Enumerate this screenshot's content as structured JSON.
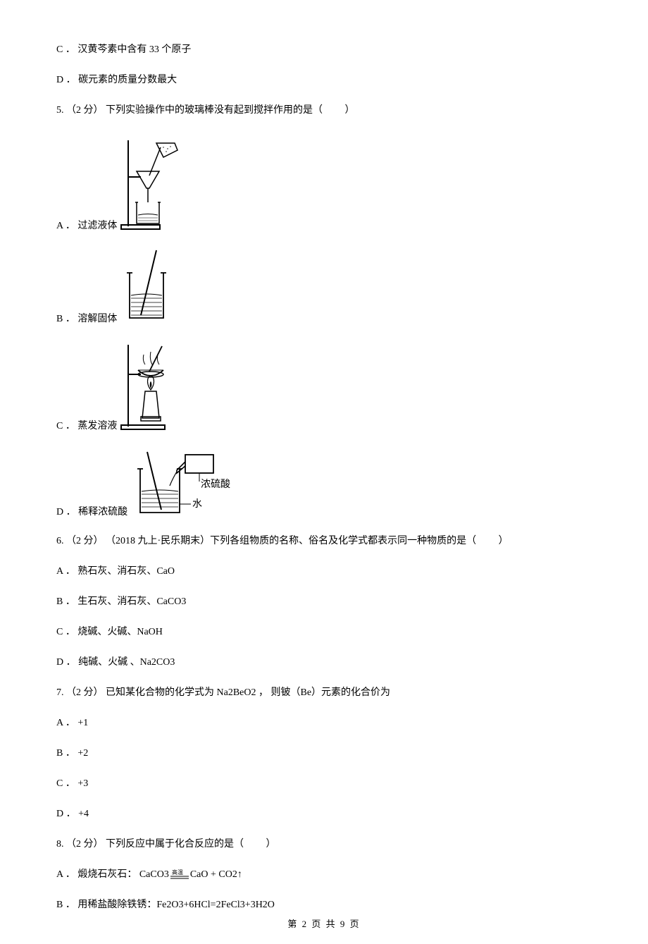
{
  "q4": {
    "optC": "C ． 汉黄芩素中含有 33 个原子",
    "optD": "D ． 碳元素的质量分数最大"
  },
  "q5": {
    "stem": "5.  （2 分）  下列实验操作中的玻璃棒没有起到搅拌作用的是（　 　）",
    "optA": "A ． 过滤液体",
    "optB": "B ． 溶解固体",
    "optC": "C ． 蒸发溶液",
    "optD": "D ． 稀释浓硫酸",
    "labelAcid": "浓硫酸",
    "labelWater": "水"
  },
  "q6": {
    "stem": "6.  （2 分） （2018 九上·民乐期末）下列各组物质的名称、俗名及化学式都表示同一种物质的是（　 　）",
    "optA": "A ． 熟石灰、消石灰、CaO",
    "optB": "B ． 生石灰、消石灰、CaCO3",
    "optC": "C ． 烧碱、火碱、NaOH",
    "optD": "D ． 纯碱、火碱 、Na2CO3"
  },
  "q7": {
    "stem": "7.  （2 分）  已知某化合物的化学式为 Na2BeO2 ，  则铍（Be）元素的化合价为",
    "optA": "A ． +1",
    "optB": "B ． +2",
    "optC": "C ． +3",
    "optD": "D ． +4"
  },
  "q8": {
    "stem": "8.  （2 分）  下列反应中属于化合反应的是（　 　）",
    "optA_pre": "A ． 煅烧石灰石：  CaCO3",
    "optA_cond": "高温",
    "optA_post": "CaO + CO2↑",
    "optB": "B ． 用稀盐酸除铁锈：Fe2O3+6HCl=2FeCl3+3H2O"
  },
  "footer": "第 2 页 共 9 页"
}
